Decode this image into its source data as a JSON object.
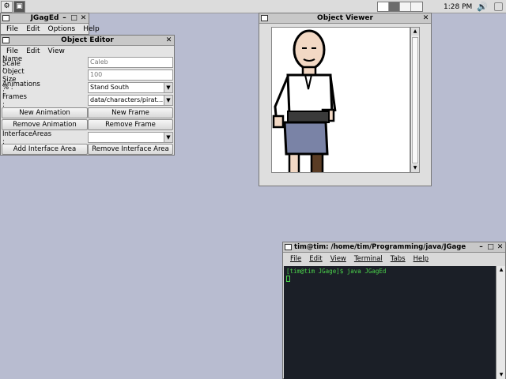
{
  "panel": {
    "clock": "1:28 PM",
    "launcher_icons": [
      "app-menu-icon",
      "terminal-launcher-icon"
    ],
    "tray_icons": [
      "speaker-icon",
      "power-icon"
    ]
  },
  "jgaged": {
    "title": "JGagEd",
    "menu": [
      "File",
      "Edit",
      "Options",
      "Help"
    ]
  },
  "object_editor": {
    "title": "Object Editor",
    "menu": [
      "File",
      "Edit",
      "View"
    ],
    "name_label": "Name :",
    "name_value": "Caleb",
    "scale_label": "Scale Object Size % :",
    "scale_value": "100",
    "animations_label": "Animations :",
    "animations_value": "Stand South",
    "frames_label": "Frames :",
    "frames_value": "data/characters/pirat...",
    "new_animation": "New Animation",
    "new_frame": "New Frame",
    "remove_animation": "Remove Animation",
    "remove_frame": "Remove Frame",
    "interface_areas_label": "InterfaceAreas :",
    "interface_areas_value": "",
    "add_interface_area": "Add Interface Area",
    "remove_interface_area": "Remove Interface Area"
  },
  "object_viewer": {
    "title": "Object Viewer"
  },
  "terminal": {
    "title": "tim@tim: /home/tim/Programming/java/JGage",
    "menu": [
      "File",
      "Edit",
      "View",
      "Terminal",
      "Tabs",
      "Help"
    ],
    "prompt_line": "[tim@tim JGage]$ java JGagEd"
  },
  "colors": {
    "desktop": "#b8bcd0",
    "terminal_bg": "#1b1f27",
    "terminal_fg": "#4bd34b"
  }
}
